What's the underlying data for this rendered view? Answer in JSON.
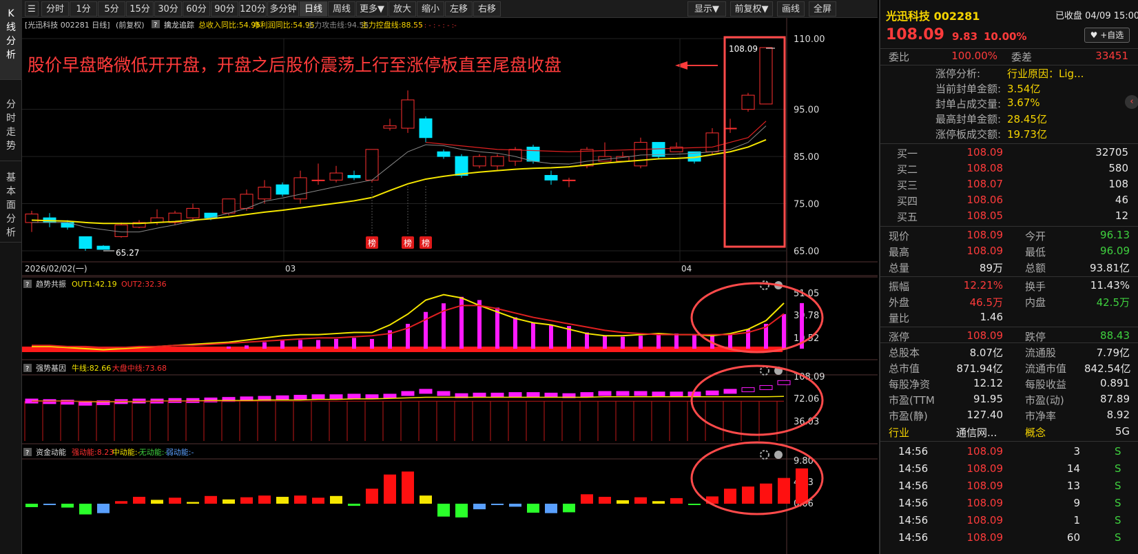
{
  "sidebar": {
    "tab_k": "K线分析",
    "tab_fs": "分时走势",
    "tab_jb": "基本面分析"
  },
  "toolbar": {
    "left": [
      "分时",
      "1分",
      "5分",
      "15分",
      "30分",
      "60分",
      "90分",
      "120分",
      "多分钟",
      "日线",
      "周线",
      "更多▼",
      "放大",
      "缩小",
      "左移",
      "右移"
    ],
    "right": [
      "显示▼",
      "前复权▼",
      "画线",
      "全屏"
    ],
    "active": "日线"
  },
  "main_legend": {
    "stock": "[光迅科技 002281 日线]",
    "fq": "(前复权)",
    "help": "?",
    "indicator": "擒龙追踪",
    "items": [
      {
        "text": "总收入同比:54.95",
        "color": "#f5d400"
      },
      {
        "text": "净利润同比:54.95",
        "color": "#f5d400"
      },
      {
        "text": "主力攻击线:94.55",
        "color": "#8a8a8a"
      },
      {
        "text": "主力控盘线:88.55",
        "color": "#f5d400"
      }
    ],
    "dots": ": - : - : - : - :-"
  },
  "annotation": {
    "text": "股价早盘略微低开开盘，开盘之后股价震荡上行至涨停板直至尾盘收盘",
    "color": "#ff3b3b"
  },
  "price_labels": {
    "last_high": "108.09",
    "low_label": "65.27",
    "bang": "榜"
  },
  "x_labels": [
    "2026/02/02(一)",
    "03",
    "04"
  ],
  "price_axis": [
    "110.00",
    "95.00",
    "85.00",
    "75.00",
    "65.00"
  ],
  "panel1": {
    "name": "趋势共振",
    "help": "?",
    "out1": "OUT1:42.19",
    "out2": "OUT2:32.36",
    "axis": [
      "51.05",
      "30.78",
      "10.52"
    ]
  },
  "panel2": {
    "name": "强势基因",
    "help": "?",
    "a": "牛线:82.66",
    "b": "大盘中线:73.68",
    "axis": [
      "108.09",
      "72.06",
      "36.03"
    ]
  },
  "panel3": {
    "name": "资金动能",
    "help": "?",
    "a": "强动能:8.23",
    "b": "中动能:-",
    "c": "无动能:-",
    "d": "弱动能:-",
    "axis": [
      "9.80",
      "4.93",
      "0.06"
    ]
  },
  "chart_data": [
    {
      "type": "candlestick",
      "title": "光迅科技 002281 日线",
      "ylim": [
        65,
        110
      ],
      "candles": [
        [
          71,
          72.8,
          69,
          73.5
        ],
        [
          72,
          71,
          70,
          73
        ],
        [
          71,
          70,
          69.5,
          71.5
        ],
        [
          68,
          65.5,
          65,
          68
        ],
        [
          66,
          65.3,
          65.27,
          66.2
        ],
        [
          68,
          70.5,
          67.8,
          71
        ],
        [
          70,
          71,
          69.8,
          71.5
        ],
        [
          71,
          72,
          70.5,
          73.8
        ],
        [
          71,
          73,
          70.5,
          73.5
        ],
        [
          72,
          74,
          71.5,
          75
        ],
        [
          73,
          72,
          71.5,
          73
        ],
        [
          73,
          76,
          72.5,
          76
        ],
        [
          74,
          77,
          73.5,
          78
        ],
        [
          76,
          78.5,
          75,
          80
        ],
        [
          79,
          77,
          76.5,
          79.5
        ],
        [
          76,
          80.5,
          75,
          82
        ],
        [
          80,
          80,
          79,
          83.5
        ],
        [
          80,
          81.5,
          79.5,
          83
        ],
        [
          81,
          80.5,
          80,
          82
        ],
        [
          80,
          86.5,
          79.5,
          86.5
        ],
        [
          91,
          91.5,
          90.5,
          93
        ],
        [
          91,
          97,
          90,
          99
        ],
        [
          93,
          89,
          88,
          93.5
        ],
        [
          86,
          85,
          84.5,
          86.5
        ],
        [
          85,
          81,
          80.5,
          85.5
        ],
        [
          83,
          85,
          82.5,
          85.5
        ],
        [
          83,
          85,
          82,
          85.5
        ],
        [
          84,
          86.5,
          83,
          87
        ],
        [
          87,
          84,
          83.5,
          87.5
        ],
        [
          81,
          80,
          79,
          82
        ],
        [
          80,
          80,
          78.5,
          80.5
        ],
        [
          83,
          86.5,
          82.5,
          87
        ],
        [
          84,
          85,
          84,
          88
        ],
        [
          84,
          85,
          84,
          86
        ],
        [
          83,
          88,
          82.5,
          89
        ],
        [
          88,
          85,
          84.5,
          88
        ],
        [
          86,
          87,
          86,
          88
        ],
        [
          86,
          84,
          83.5,
          86
        ],
        [
          86,
          90,
          85.5,
          91
        ],
        [
          91,
          91,
          90,
          93
        ],
        [
          95,
          98,
          94.5,
          98.5
        ],
        [
          96.13,
          108.09,
          96.09,
          108.09
        ]
      ],
      "ma_gray": [
        71,
        71,
        71,
        70,
        69.5,
        69,
        69,
        69.8,
        70.5,
        71.3,
        72,
        73,
        74,
        75.5,
        76.2,
        77,
        77.8,
        78.6,
        79.3,
        80,
        83,
        86,
        87.5,
        87.3,
        86.5,
        86,
        85.7,
        85,
        84,
        83.5,
        83.4,
        84,
        84.4,
        84.8,
        85.3,
        85.4,
        85.5,
        85.7,
        86,
        86.5,
        88,
        91.5
      ],
      "ma_yellow": [
        71.5,
        71.4,
        71.3,
        71,
        70.8,
        70.8,
        70.8,
        71,
        71.2,
        71.5,
        71.8,
        72.2,
        72.7,
        73.2,
        73.6,
        74.1,
        74.6,
        75.1,
        75.6,
        76.3,
        77.8,
        79.2,
        80.2,
        80.8,
        81.3,
        81.7,
        82,
        82.3,
        82.5,
        82.6,
        82.8,
        83.2,
        83.6,
        83.9,
        84.2,
        84.5,
        84.6,
        84.8,
        85.4,
        86,
        87,
        88.55
      ]
    },
    {
      "type": "bar+line",
      "title": "趋势共振",
      "ylim": [
        0,
        55
      ],
      "bars": [
        0,
        0,
        0,
        0,
        0,
        0,
        0,
        0,
        0,
        0,
        0,
        2,
        3,
        6,
        8,
        8,
        8,
        9,
        10,
        9,
        17,
        23,
        34,
        42,
        48,
        45,
        38,
        29,
        24,
        22,
        21,
        15,
        12,
        11,
        12,
        13,
        14,
        13,
        13,
        13,
        18,
        23,
        32,
        42.19
      ],
      "out1": [
        2,
        2,
        1,
        0,
        -1,
        0,
        1,
        2,
        3,
        4,
        5,
        6,
        8,
        10,
        12,
        13,
        13,
        14,
        15,
        15,
        22,
        32,
        45,
        50,
        47,
        40,
        34,
        28,
        24,
        22,
        18,
        14,
        12,
        12,
        13,
        14,
        13,
        13,
        12,
        14,
        18,
        26,
        42.19
      ],
      "out2": [
        3,
        3,
        2,
        2,
        1,
        1,
        2,
        2,
        3,
        3,
        4,
        5,
        6,
        7,
        8,
        9,
        10,
        10,
        11,
        12,
        14,
        19,
        27,
        35,
        40,
        40,
        37,
        33,
        29,
        26,
        23,
        20,
        17,
        15,
        14,
        13,
        13,
        13,
        13,
        13,
        15,
        20,
        32.36
      ]
    },
    {
      "type": "bar+line",
      "title": "强势基因",
      "ylim": [
        0,
        120
      ],
      "values": [
        74,
        73,
        72,
        70,
        71,
        73,
        74,
        74,
        75,
        75,
        76,
        77,
        78,
        79,
        80,
        81,
        82,
        82,
        83,
        82,
        83,
        88,
        92,
        88,
        84,
        85,
        85,
        86,
        86,
        85,
        84,
        86,
        88,
        88,
        88,
        87,
        87,
        87,
        89,
        92,
        95,
        99,
        108.09
      ],
      "line_a": [
        74,
        74,
        74,
        73,
        73,
        73,
        73,
        74,
        74,
        74,
        75,
        75,
        75,
        76,
        76,
        76,
        77,
        77,
        78,
        78,
        79,
        80,
        81,
        81,
        81,
        81,
        81,
        81,
        81,
        81,
        81,
        81,
        82,
        82,
        82,
        82,
        82,
        82,
        82,
        82,
        82,
        82,
        82.66
      ],
      "line_b": [
        73.68,
        73.68,
        73.68,
        73.68,
        73.68,
        73.68,
        73.68,
        73.68,
        73.68,
        73.68,
        73.68,
        73.68,
        73.68,
        73.68,
        73.68,
        73.68,
        73.68,
        73.68,
        73.68,
        73.68,
        73.68,
        73.68,
        73.68,
        73.68,
        73.68,
        73.68,
        73.68,
        73.68,
        73.68,
        73.68,
        73.68,
        73.68,
        73.68,
        73.68,
        73.68,
        73.68,
        73.68,
        73.68,
        73.68,
        73.68,
        73.68,
        73.68,
        73.68
      ]
    },
    {
      "type": "bar",
      "title": "资金动能",
      "ylim": [
        -3,
        10
      ],
      "values": [
        -0.8,
        -0.3,
        -0.9,
        -2.5,
        -2.2,
        0.6,
        1.6,
        0.9,
        1.4,
        0.4,
        1.8,
        1.0,
        1.5,
        1.9,
        1.6,
        1.9,
        1.4,
        1.8,
        -0.5,
        3.5,
        6.8,
        7.5,
        1.9,
        -3.0,
        -3.2,
        -1.3,
        -0.3,
        -0.7,
        -2.1,
        -2.2,
        -2.0,
        2.2,
        1.6,
        0.8,
        1.5,
        0.6,
        1.3,
        -0.3,
        1.7,
        3.5,
        4.0,
        4.7,
        6.0,
        8.23
      ],
      "colors": [
        "#2aff2a",
        "#5aa0ff",
        "#2aff2a",
        "#2aff2a",
        "#5aa0ff",
        "#ff1010",
        "#ff1010",
        "#f5e600",
        "#ff1010",
        "#f5e600",
        "#ff1010",
        "#f5e600",
        "#ff1010",
        "#ff1010",
        "#f5e600",
        "#ff1010",
        "#ff1010",
        "#f5e600",
        "#2aff2a",
        "#ff1010",
        "#ff1010",
        "#ff1010",
        "#f5e600",
        "#2aff2a",
        "#2aff2a",
        "#5aa0ff",
        "#5aa0ff",
        "#5aa0ff",
        "#2aff2a",
        "#5aa0ff",
        "#2aff2a",
        "#ff1010",
        "#ff1010",
        "#f5e600",
        "#ff1010",
        "#f5e600",
        "#ff1010",
        "#2aff2a",
        "#ff1010",
        "#ff1010",
        "#ff1010",
        "#ff1010",
        "#ff1010",
        "#ff1010"
      ]
    }
  ],
  "quote": {
    "title": "光迅科技 002281",
    "status": "已收盘 04/09 15:00",
    "price": "108.09",
    "change": "9.83",
    "pct": "10.00%",
    "fav": "+自选",
    "wb_l": "委比",
    "wb_v": "100.00%",
    "wc_l": "委差",
    "wc_v": "33451",
    "zt_rows": [
      {
        "l": "涨停分析:",
        "v": "行业原因：Lig..."
      },
      {
        "l": "当前封单金额:",
        "v": "3.54亿"
      },
      {
        "l": "封单占成交量:",
        "v": "3.67%"
      },
      {
        "l": "最高封单金额:",
        "v": "28.45亿"
      },
      {
        "l": "涨停板成交额:",
        "v": "19.73亿"
      }
    ],
    "buy": [
      {
        "l": "买一",
        "p": "108.09",
        "v": "32705"
      },
      {
        "l": "买二",
        "p": "108.08",
        "v": "580"
      },
      {
        "l": "买三",
        "p": "108.07",
        "v": "108"
      },
      {
        "l": "买四",
        "p": "108.06",
        "v": "46"
      },
      {
        "l": "买五",
        "p": "108.05",
        "v": "12"
      }
    ],
    "stats": [
      [
        {
          "l": "现价",
          "v": "108.09",
          "c": "red"
        },
        {
          "l": "今开",
          "v": "96.13",
          "c": "grn"
        }
      ],
      [
        {
          "l": "最高",
          "v": "108.09",
          "c": "red"
        },
        {
          "l": "最低",
          "v": "96.09",
          "c": "grn"
        }
      ],
      [
        {
          "l": "总量",
          "v": "89万",
          "c": "wht"
        },
        {
          "l": "总额",
          "v": "93.81亿",
          "c": "wht"
        }
      ],
      [
        {
          "l": "振幅",
          "v": "12.21%",
          "c": "red"
        },
        {
          "l": "换手",
          "v": "11.43%",
          "c": "wht"
        }
      ],
      [
        {
          "l": "外盘",
          "v": "46.5万",
          "c": "red"
        },
        {
          "l": "内盘",
          "v": "42.5万",
          "c": "grn"
        }
      ],
      [
        {
          "l": "量比",
          "v": "1.46",
          "c": "wht"
        },
        {
          "l": "",
          "v": "",
          "c": "wht"
        }
      ],
      [
        {
          "l": "涨停",
          "v": "108.09",
          "c": "red"
        },
        {
          "l": "跌停",
          "v": "88.43",
          "c": "grn"
        }
      ],
      [
        {
          "l": "总股本",
          "v": "8.07亿",
          "c": "wht"
        },
        {
          "l": "流通股",
          "v": "7.79亿",
          "c": "wht"
        }
      ],
      [
        {
          "l": "总市值",
          "v": "871.94亿",
          "c": "wht"
        },
        {
          "l": "流通市值",
          "v": "842.54亿",
          "c": "wht"
        }
      ],
      [
        {
          "l": "每股净资",
          "v": "12.12",
          "c": "wht"
        },
        {
          "l": "每股收益",
          "v": "0.891",
          "c": "wht"
        }
      ],
      [
        {
          "l": "市盈(TTM",
          "v": "91.95",
          "c": "wht"
        },
        {
          "l": "市盈(动)",
          "v": "87.89",
          "c": "wht"
        }
      ],
      [
        {
          "l": "市盈(静)",
          "v": "127.40",
          "c": "wht"
        },
        {
          "l": "市净率",
          "v": "8.92",
          "c": "wht"
        }
      ]
    ],
    "industry_l": "行业",
    "industry_v": "通信网...",
    "concept_l": "概念",
    "concept_v": "5G",
    "ticks": [
      {
        "t": "14:56",
        "p": "108.09",
        "v": "3",
        "s": "S"
      },
      {
        "t": "14:56",
        "p": "108.09",
        "v": "14",
        "s": "S"
      },
      {
        "t": "14:56",
        "p": "108.09",
        "v": "13",
        "s": "S"
      },
      {
        "t": "14:56",
        "p": "108.09",
        "v": "9",
        "s": "S"
      },
      {
        "t": "14:56",
        "p": "108.09",
        "v": "1",
        "s": "S"
      },
      {
        "t": "14:56",
        "p": "108.09",
        "v": "60",
        "s": "S"
      }
    ]
  }
}
